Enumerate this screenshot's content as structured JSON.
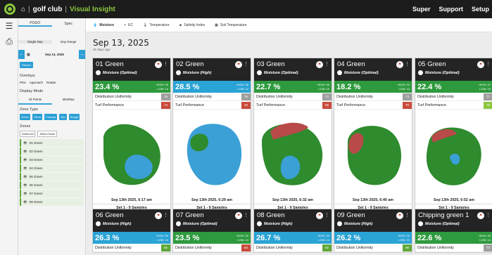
{
  "header": {
    "app": "golf club",
    "sep": "|",
    "title": "Visual Insight",
    "nav": [
      "Super",
      "Support",
      "Setup"
    ]
  },
  "sidebar": {
    "tabs": [
      "POGO",
      "Spec"
    ],
    "day": [
      "Single Day",
      "Day Range"
    ],
    "date": "Sep 13, 2025",
    "reload": "Reload",
    "overlays": "Overlays",
    "ov": [
      "Pins",
      "Approach",
      "Rotate"
    ],
    "display": "Display Mode",
    "modes": [
      "All Points",
      "Min/Max"
    ],
    "zonetype": "Zone Type",
    "zt": [
      "Green",
      "Other",
      "Fairway",
      "Tee",
      "Rough"
    ],
    "zones": "Zones",
    "sel": [
      "Select All",
      "Select None"
    ],
    "zonelist": [
      "01 Green",
      "02 Green",
      "03 Green",
      "04 Green",
      "05 Green",
      "06 Green",
      "07 Green",
      "08 Green"
    ]
  },
  "tabs": [
    "Moisture",
    "EC",
    "Temperature",
    "Salinity Index",
    "Soil Temperature"
  ],
  "page": {
    "date": "Sep 13, 2025",
    "ago": "25 days ago"
  },
  "labels": {
    "du": "Distribution Uniformity",
    "tp": "Turf Performance"
  },
  "cards": [
    {
      "name": "01 Green",
      "m": "Moisture (Optimal)",
      "val": "23.4 %",
      "hi": "HIGH: 25",
      "lo": "LOW: 16",
      "du": "75",
      "tp": "74",
      "date": "Sep 13th 2025, 6:17 am",
      "set": "Set 1 - 9 Samples",
      "color": "#2e9a3e"
    },
    {
      "name": "02 Green",
      "m": "Moisture (High)",
      "val": "28.5 %",
      "hi": "HIGH: 35",
      "lo": "LOW: 12",
      "du": "75",
      "tp": "40",
      "date": "Sep 13th 2025, 6:29 am",
      "set": "Set 1 - 9 Samples",
      "color": "#2aa3d5"
    },
    {
      "name": "03 Green",
      "m": "Moisture (Optimal)",
      "val": "22.7 %",
      "hi": "HIGH: 30",
      "lo": "LOW: 10",
      "du": "72",
      "tp": "65",
      "date": "Sep 13th 2025, 6:32 am",
      "set": "Set 1 - 9 Samples",
      "color": "#2e9a3e"
    },
    {
      "name": "04 Green",
      "m": "Moisture (Optimal)",
      "val": "18.2 %",
      "hi": "HIGH: 22",
      "lo": "LOW: 13",
      "du": "73",
      "tp": "70",
      "date": "Sep 13th 2025, 6:40 am",
      "set": "Set 1 - 9 Samples",
      "color": "#2e9a3e"
    },
    {
      "name": "05 Green",
      "m": "Moisture (Optimal)",
      "val": "22.4 %",
      "hi": "HIGH: 27",
      "lo": "LOW: 15",
      "du": "77",
      "tp": "75",
      "date": "Sep 13th 2025, 6:52 am",
      "set": "Set 1 - 9 Samples",
      "color": "#2e9a3e"
    },
    {
      "name": "06 Green",
      "m": "Moisture (High)",
      "val": "26.3 %",
      "hi": "HIGH: 30",
      "lo": "LOW: 24",
      "du": "92",
      "date": "",
      "set": "",
      "color": "#2aa3d5"
    },
    {
      "name": "07 Green",
      "m": "Moisture (Optimal)",
      "val": "23.5 %",
      "hi": "HIGH: 33",
      "lo": "LOW: 13",
      "du": "64",
      "date": "",
      "set": "",
      "color": "#2e9a3e"
    },
    {
      "name": "08 Green",
      "m": "Moisture (High)",
      "val": "26.7 %",
      "hi": "HIGH: 30",
      "lo": "LOW: 14",
      "du": "92",
      "date": "",
      "set": "",
      "color": "#2aa3d5"
    },
    {
      "name": "09 Green",
      "m": "Moisture (High)",
      "val": "26.2 %",
      "hi": "HIGH: 32",
      "lo": "LOW: 23",
      "du": "90",
      "date": "",
      "set": "",
      "color": "#2aa3d5"
    },
    {
      "name": "Chipping green 1",
      "m": "Moisture (Optimal)",
      "val": "22.6 %",
      "hi": "HIGH: 26",
      "lo": "LOW: 14",
      "du": "70",
      "date": "",
      "set": "",
      "color": "#2e9a3e"
    }
  ]
}
